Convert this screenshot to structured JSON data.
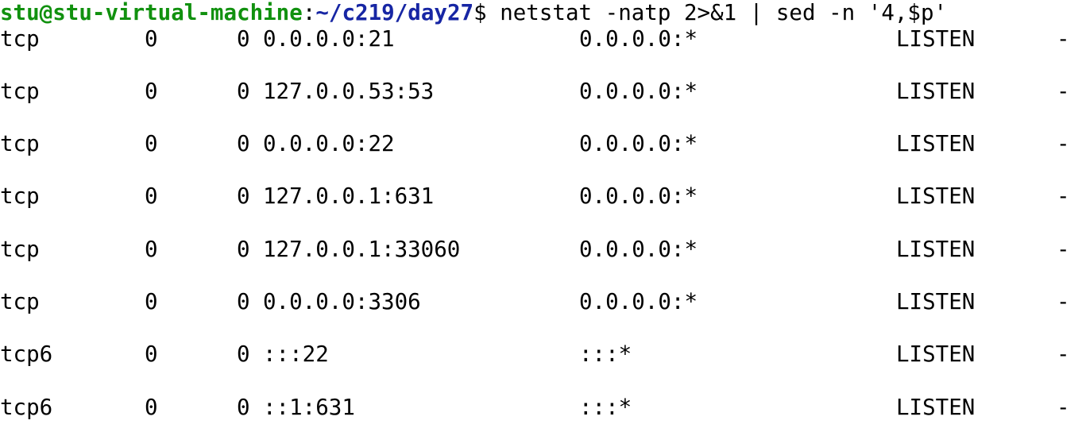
{
  "prompt": {
    "user_host": "stu@stu-virtual-machine",
    "colon": ":",
    "cwd": "~/c219/day27",
    "dollar": "$",
    "command": "netstat -natp 2>&1 | sed -n '4,$p'"
  },
  "colors": {
    "user_host": "#11910f",
    "cwd": "#1726a4",
    "text": "#000000",
    "background": "#ffffff"
  },
  "rows": [
    {
      "proto": "tcp",
      "recvq": "0",
      "sendq": "0",
      "local": "0.0.0.0:21",
      "foreign": "0.0.0.0:*",
      "state": "LISTEN",
      "pid": "-"
    },
    {
      "proto": "tcp",
      "recvq": "0",
      "sendq": "0",
      "local": "127.0.0.53:53",
      "foreign": "0.0.0.0:*",
      "state": "LISTEN",
      "pid": "-"
    },
    {
      "proto": "tcp",
      "recvq": "0",
      "sendq": "0",
      "local": "0.0.0.0:22",
      "foreign": "0.0.0.0:*",
      "state": "LISTEN",
      "pid": "-"
    },
    {
      "proto": "tcp",
      "recvq": "0",
      "sendq": "0",
      "local": "127.0.0.1:631",
      "foreign": "0.0.0.0:*",
      "state": "LISTEN",
      "pid": "-"
    },
    {
      "proto": "tcp",
      "recvq": "0",
      "sendq": "0",
      "local": "127.0.0.1:33060",
      "foreign": "0.0.0.0:*",
      "state": "LISTEN",
      "pid": "-"
    },
    {
      "proto": "tcp",
      "recvq": "0",
      "sendq": "0",
      "local": "0.0.0.0:3306",
      "foreign": "0.0.0.0:*",
      "state": "LISTEN",
      "pid": "-"
    },
    {
      "proto": "tcp6",
      "recvq": "0",
      "sendq": "0",
      "local": ":::22",
      "foreign": ":::*",
      "state": "LISTEN",
      "pid": "-"
    },
    {
      "proto": "tcp6",
      "recvq": "0",
      "sendq": "0",
      "local": "::1:631",
      "foreign": ":::*",
      "state": "LISTEN",
      "pid": "-"
    }
  ]
}
